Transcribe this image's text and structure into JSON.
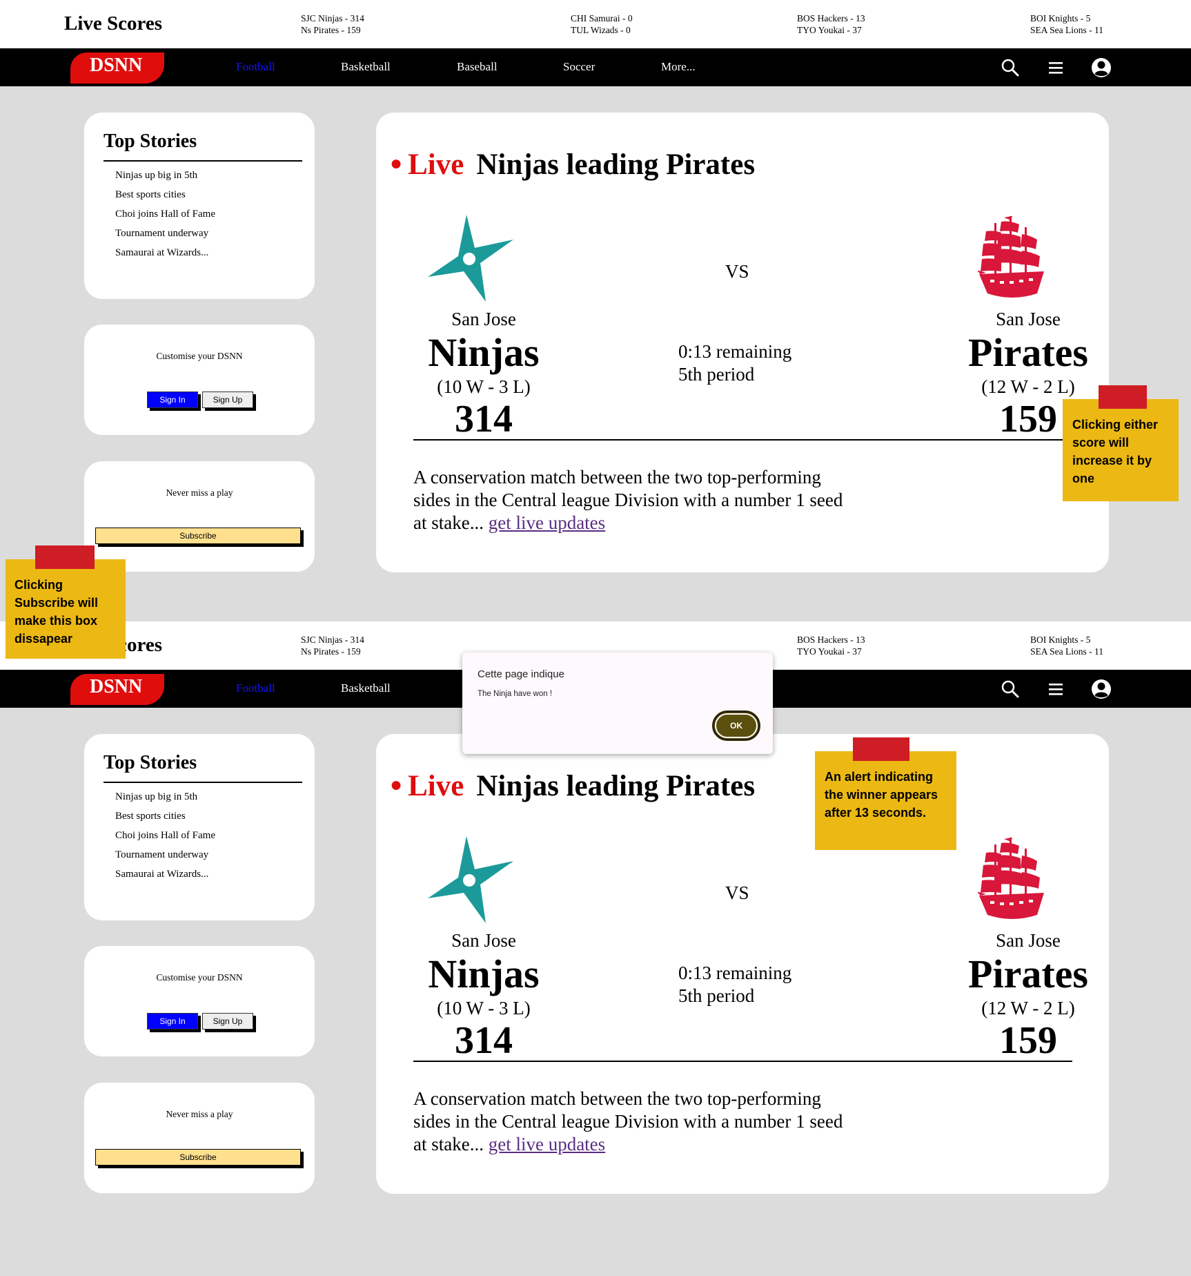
{
  "header": {
    "title": "Live Scores",
    "scores": [
      {
        "line1": "SJC Ninjas - 314",
        "line2": "Ns Pirates - 159"
      },
      {
        "line1": "CHI Samurai - 0",
        "line2": "TUL Wizads - 0"
      },
      {
        "line1": "BOS Hackers - 13",
        "line2": "TYO Youkai - 37"
      },
      {
        "line1": "BOI Knights - 5",
        "line2": "SEA Sea Lions - 11"
      }
    ]
  },
  "nav": {
    "logo": "DSNN",
    "items": [
      "Football",
      "Basketball",
      "Baseball",
      "Soccer",
      "More..."
    ],
    "icons": [
      "search-icon",
      "menu-icon",
      "user-icon"
    ]
  },
  "sidebar": {
    "stories_title": "Top Stories",
    "stories": [
      "Ninjas up big in 5th",
      "Best sports cities",
      "Choi joins Hall of Fame",
      "Tournament underway",
      "Samaurai at Wizards..."
    ],
    "customise_label": "Customise your DSNN",
    "sign_in": "Sign In",
    "sign_up": "Sign Up",
    "subscribe_caption": "Never miss a play",
    "subscribe_button": "Subscribe"
  },
  "game": {
    "live_label": "Live",
    "headline": "Ninjas leading Pirates",
    "vs": "VS",
    "time_remaining": "0:13 remaining",
    "period": "5th period",
    "home": {
      "city": "San Jose",
      "name": "Ninjas",
      "record": "(10 W - 3 L)",
      "score": "314",
      "icon": "shuriken-icon",
      "color": "#1c9a9a"
    },
    "away": {
      "city": "San Jose",
      "name": "Pirates",
      "record": "(12 W - 2 L)",
      "score": "159",
      "icon": "pirate-ship-icon",
      "color": "#d8173a"
    },
    "description": "A conservation match between the two top-performing sides in the Central league Division with a number 1 seed at stake... ",
    "link": "get live updates"
  },
  "alert": {
    "title": "Cette page indique",
    "message": "The Ninja have won !",
    "ok": "OK"
  },
  "notes": {
    "score": "Clicking either score will increase it by one",
    "subscribe": "Clicking Subscribe will make this box dissapear",
    "alert": "An alert indicating the winner appears after 13 seconds."
  },
  "colors": {
    "accent_red": "#e00d0d",
    "sticky": "#ecb813",
    "tape": "#ce1d24",
    "link": "#5a2d82"
  }
}
